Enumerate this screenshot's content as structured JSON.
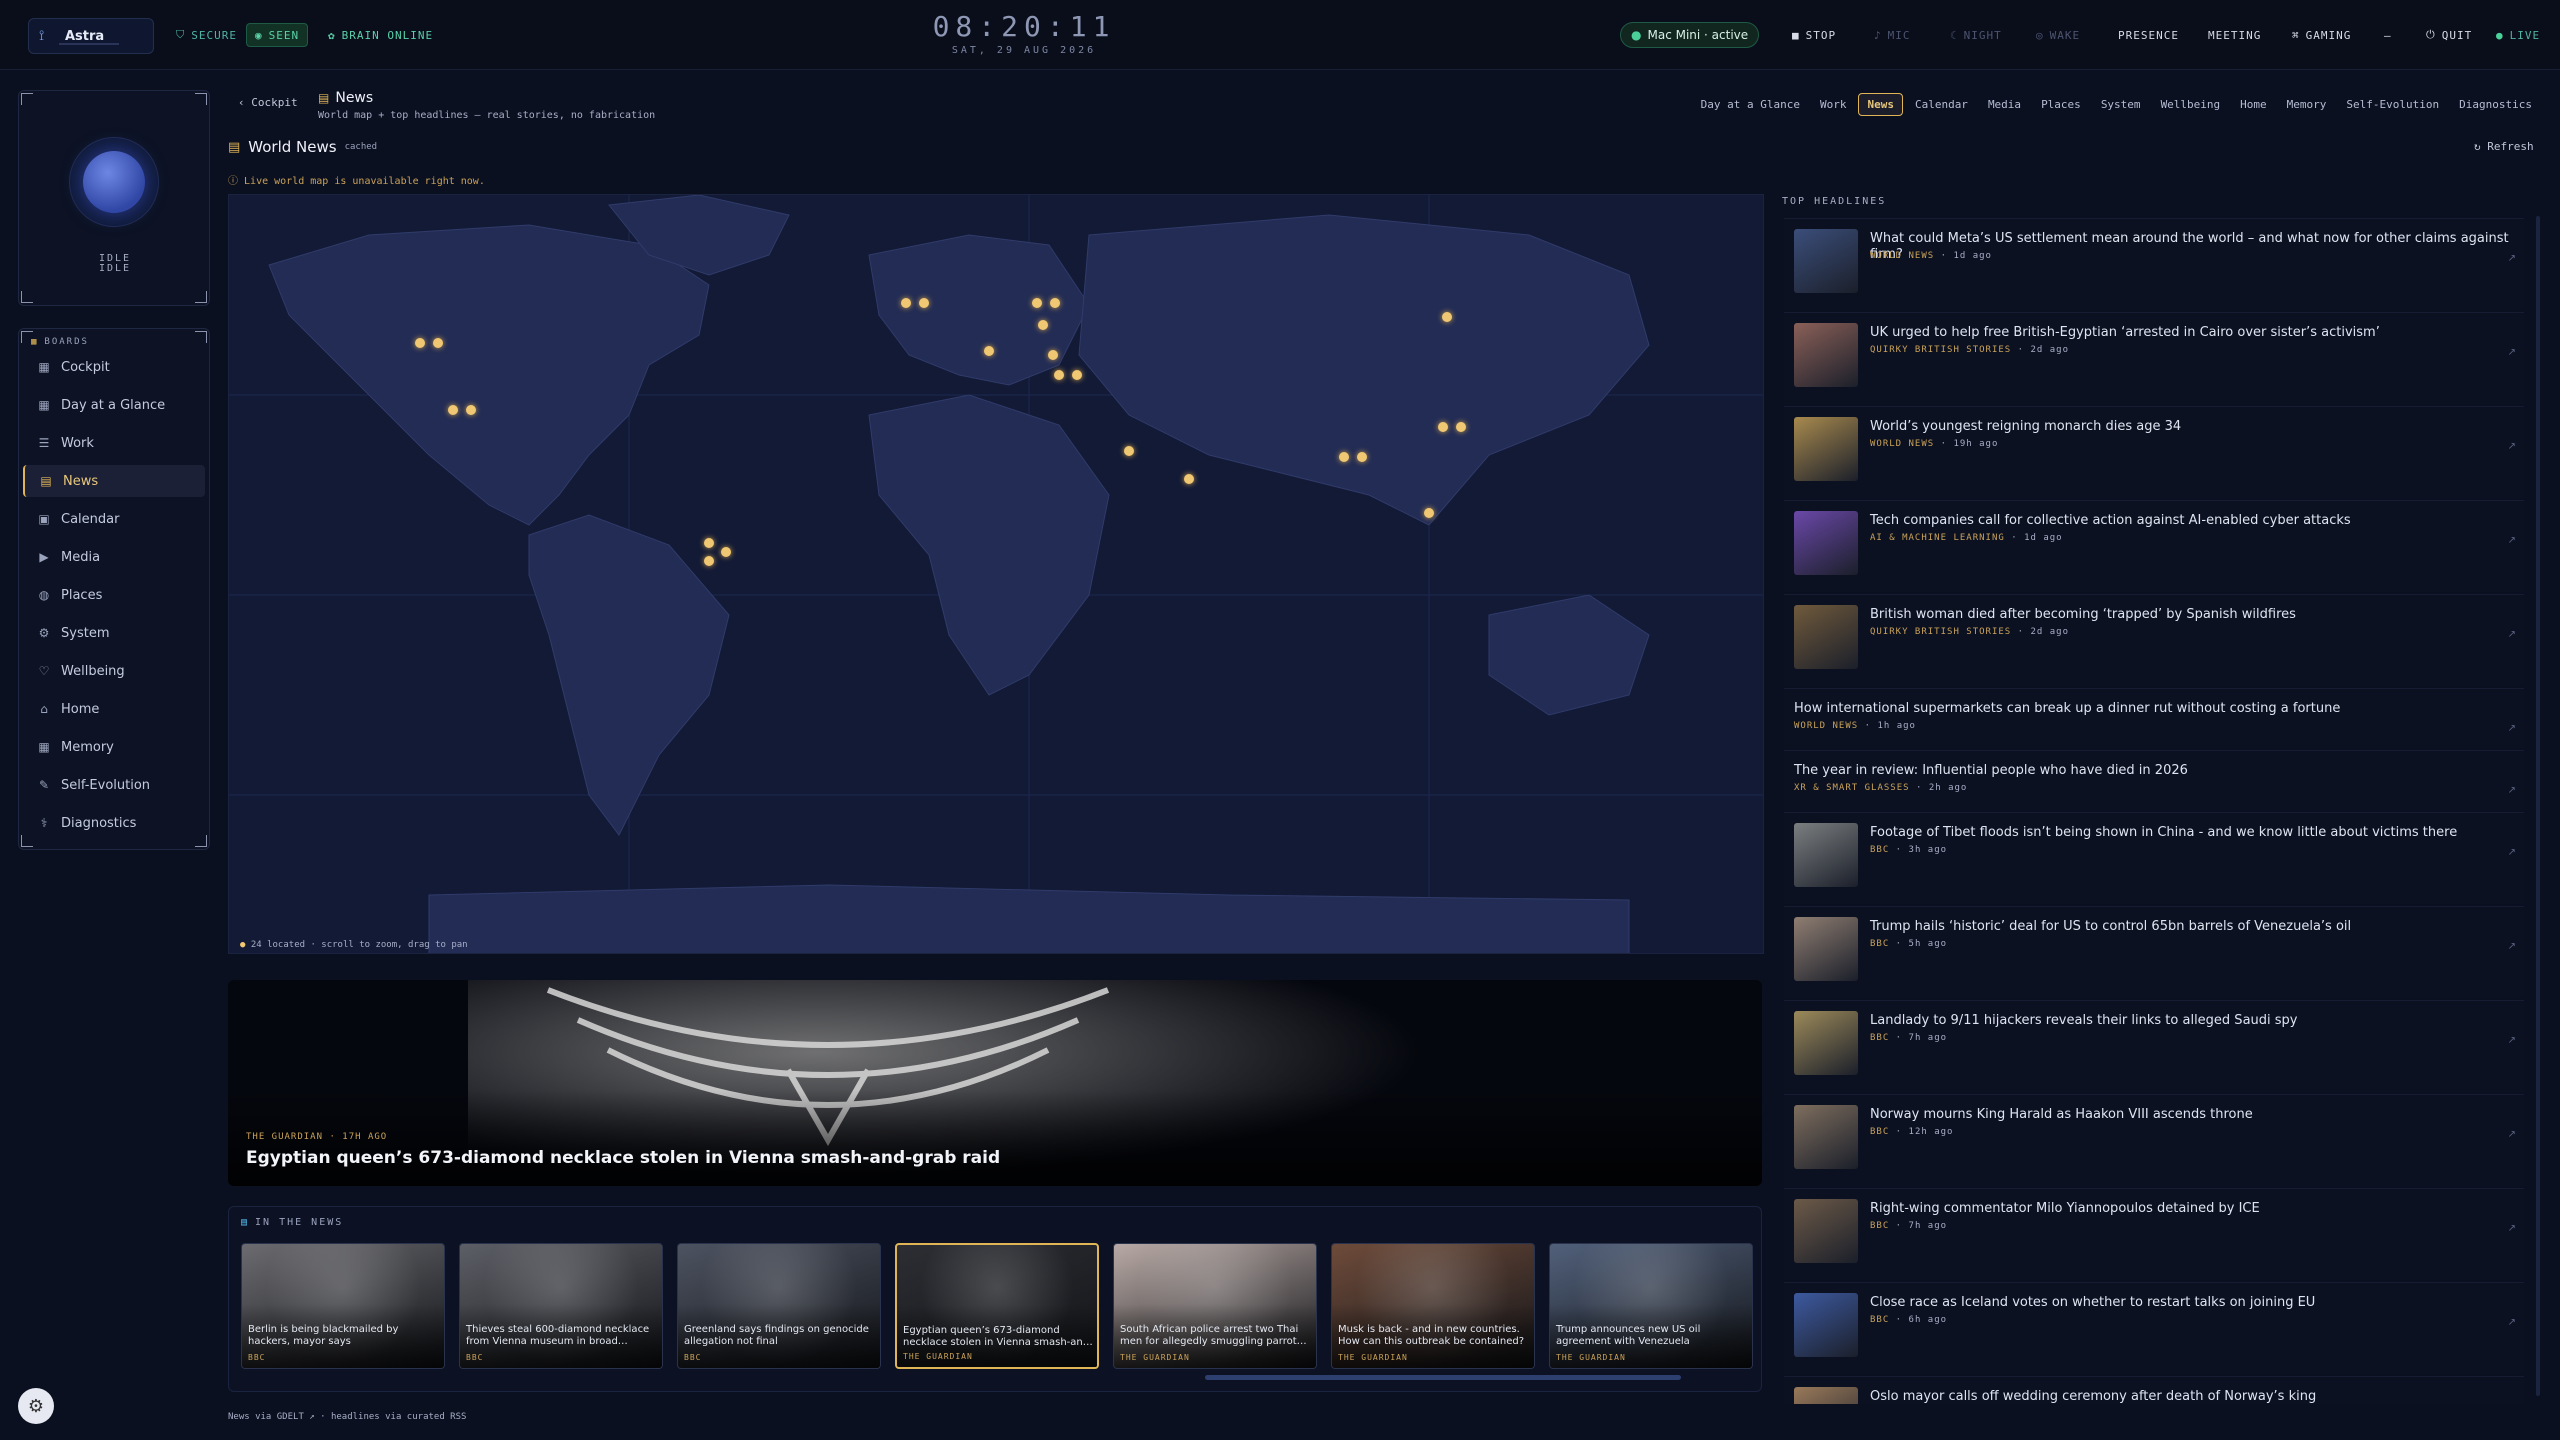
{
  "topbar": {
    "brand": "Astra",
    "secure": "SECURE",
    "seen": "SEEN",
    "brain": "BRAIN ONLINE",
    "time": "08:20:11",
    "date": "SAT, 29 AUG 2026",
    "device": "Mac Mini · active",
    "stop": "STOP",
    "mic": "MIC",
    "night": "NIGHT",
    "wake": "WAKE",
    "presence": "PRESENCE",
    "meeting": "MEETING",
    "gaming": "GAMING",
    "minimize": "—",
    "quit": "QUIT",
    "live": "LIVE"
  },
  "sidebar": {
    "state": "IDLE",
    "state2": "IDLE",
    "boards_label": "BOARDS",
    "items": [
      {
        "label": "Cockpit",
        "icon": "grid-icon"
      },
      {
        "label": "Day at a Glance",
        "icon": "grid-icon"
      },
      {
        "label": "Work",
        "icon": "list-icon"
      },
      {
        "label": "News",
        "icon": "news-icon"
      },
      {
        "label": "Calendar",
        "icon": "calendar-icon"
      },
      {
        "label": "Media",
        "icon": "play-icon"
      },
      {
        "label": "Places",
        "icon": "globe-icon"
      },
      {
        "label": "System",
        "icon": "gear-icon"
      },
      {
        "label": "Wellbeing",
        "icon": "heart-icon"
      },
      {
        "label": "Home",
        "icon": "home-icon"
      },
      {
        "label": "Memory",
        "icon": "grid-icon"
      },
      {
        "label": "Self-Evolution",
        "icon": "wrench-icon"
      },
      {
        "label": "Diagnostics",
        "icon": "stethoscope-icon"
      }
    ]
  },
  "header": {
    "back": "Cockpit",
    "title": "News",
    "subtitle": "World map + top headlines — real stories, no fabrication",
    "tabs": [
      "Day at a Glance",
      "Work",
      "News",
      "Calendar",
      "Media",
      "Places",
      "System",
      "Wellbeing",
      "Home",
      "Memory",
      "Self-Evolution",
      "Diagnostics"
    ],
    "active_tab": "News"
  },
  "world": {
    "title": "World News",
    "cached": "cached",
    "refresh": "Refresh",
    "warning": "Live world map is unavailable right now.",
    "legend": "24 located · scroll to zoom, drag to pan"
  },
  "hero": {
    "source": "THE GUARDIAN · 17H AGO",
    "title": "Egyptian queen’s 673-diamond necklace stolen in Vienna smash-and-grab raid"
  },
  "in_the_news": {
    "title": "IN THE NEWS",
    "cards": [
      {
        "caption": "Berlin is being blackmailed by hackers, mayor says",
        "source": "BBC",
        "bg": "#6b6b70"
      },
      {
        "caption": "Thieves steal 600-diamond necklace from Vienna museum in broad…",
        "source": "BBC",
        "bg": "#5d5f66"
      },
      {
        "caption": "Greenland says findings on genocide allegation not final",
        "source": "BBC",
        "bg": "#4d5361"
      },
      {
        "caption": "Egyptian queen’s 673-diamond necklace stolen in Vienna smash-an…",
        "source": "THE GUARDIAN",
        "bg": "#2c2e33"
      },
      {
        "caption": "South African police arrest two Thai men for allegedly smuggling parrot…",
        "source": "THE GUARDIAN",
        "bg": "#b9aaa6"
      },
      {
        "caption": "Musk is back - and in new countries. How can this outbreak be contained?",
        "source": "THE GUARDIAN",
        "bg": "#6e4b3a"
      },
      {
        "caption": "Trump announces new US oil agreement with Venezuela",
        "source": "THE GUARDIAN",
        "bg": "#51607a"
      }
    ]
  },
  "footer": "News via GDELT ↗ · headlines via curated RSS",
  "headlines": {
    "title": "TOP HEADLINES",
    "items": [
      {
        "title": "What could Meta’s US settlement mean around the world – and what now for other claims against firm?",
        "source": "WORLD NEWS",
        "age": "1d ago",
        "thumb": "#3b4e7a"
      },
      {
        "title": "UK urged to help free British-Egyptian ‘arrested in Cairo over sister’s activism’",
        "source": "QUIRKY BRITISH STORIES",
        "age": "2d ago",
        "thumb": "#8a6058"
      },
      {
        "title": "World’s youngest reigning monarch dies age 34",
        "source": "WORLD NEWS",
        "age": "19h ago",
        "thumb": "#a88a4e"
      },
      {
        "title": "Tech companies call for collective action against AI-enabled cyber attacks",
        "source": "AI & MACHINE LEARNING",
        "age": "1d ago",
        "thumb": "#6a48a8"
      },
      {
        "title": "British woman died after becoming ‘trapped’ by Spanish wildfires",
        "source": "QUIRKY BRITISH STORIES",
        "age": "2d ago",
        "thumb": "#705a3c"
      },
      {
        "title": "How international supermarkets can break up a dinner rut without costing a fortune",
        "source": "WORLD NEWS",
        "age": "1h ago",
        "thumb": ""
      },
      {
        "title": "The year in review: Influential people who have died in 2026",
        "source": "XR & SMART GLASSES",
        "age": "2h ago",
        "thumb": ""
      },
      {
        "title": "Footage of Tibet floods isn’t being shown in China - and we know little about victims there",
        "source": "BBC",
        "age": "3h ago",
        "thumb": "#7c7f80"
      },
      {
        "title": "Trump hails ‘historic’ deal for US to control 65bn barrels of Venezuela’s oil",
        "source": "BBC",
        "age": "5h ago",
        "thumb": "#8f7e72"
      },
      {
        "title": "Landlady to 9/11 hijackers reveals their links to alleged Saudi spy",
        "source": "BBC",
        "age": "7h ago",
        "thumb": "#9c8a5a"
      },
      {
        "title": "Norway mourns King Harald as Haakon VIII ascends throne",
        "source": "BBC",
        "age": "12h ago",
        "thumb": "#7e6e5e"
      },
      {
        "title": "Right-wing commentator Milo Yiannopoulos detained by ICE",
        "source": "BBC",
        "age": "7h ago",
        "thumb": "#6c5a48"
      },
      {
        "title": "Close race as Iceland votes on whether to restart talks on joining EU",
        "source": "BBC",
        "age": "6h ago",
        "thumb": "#3d5aa0"
      },
      {
        "title": "Oslo mayor calls off wedding ceremony after death of Norway’s king",
        "source": "",
        "age": "",
        "thumb": "#9a7a5a"
      }
    ]
  }
}
